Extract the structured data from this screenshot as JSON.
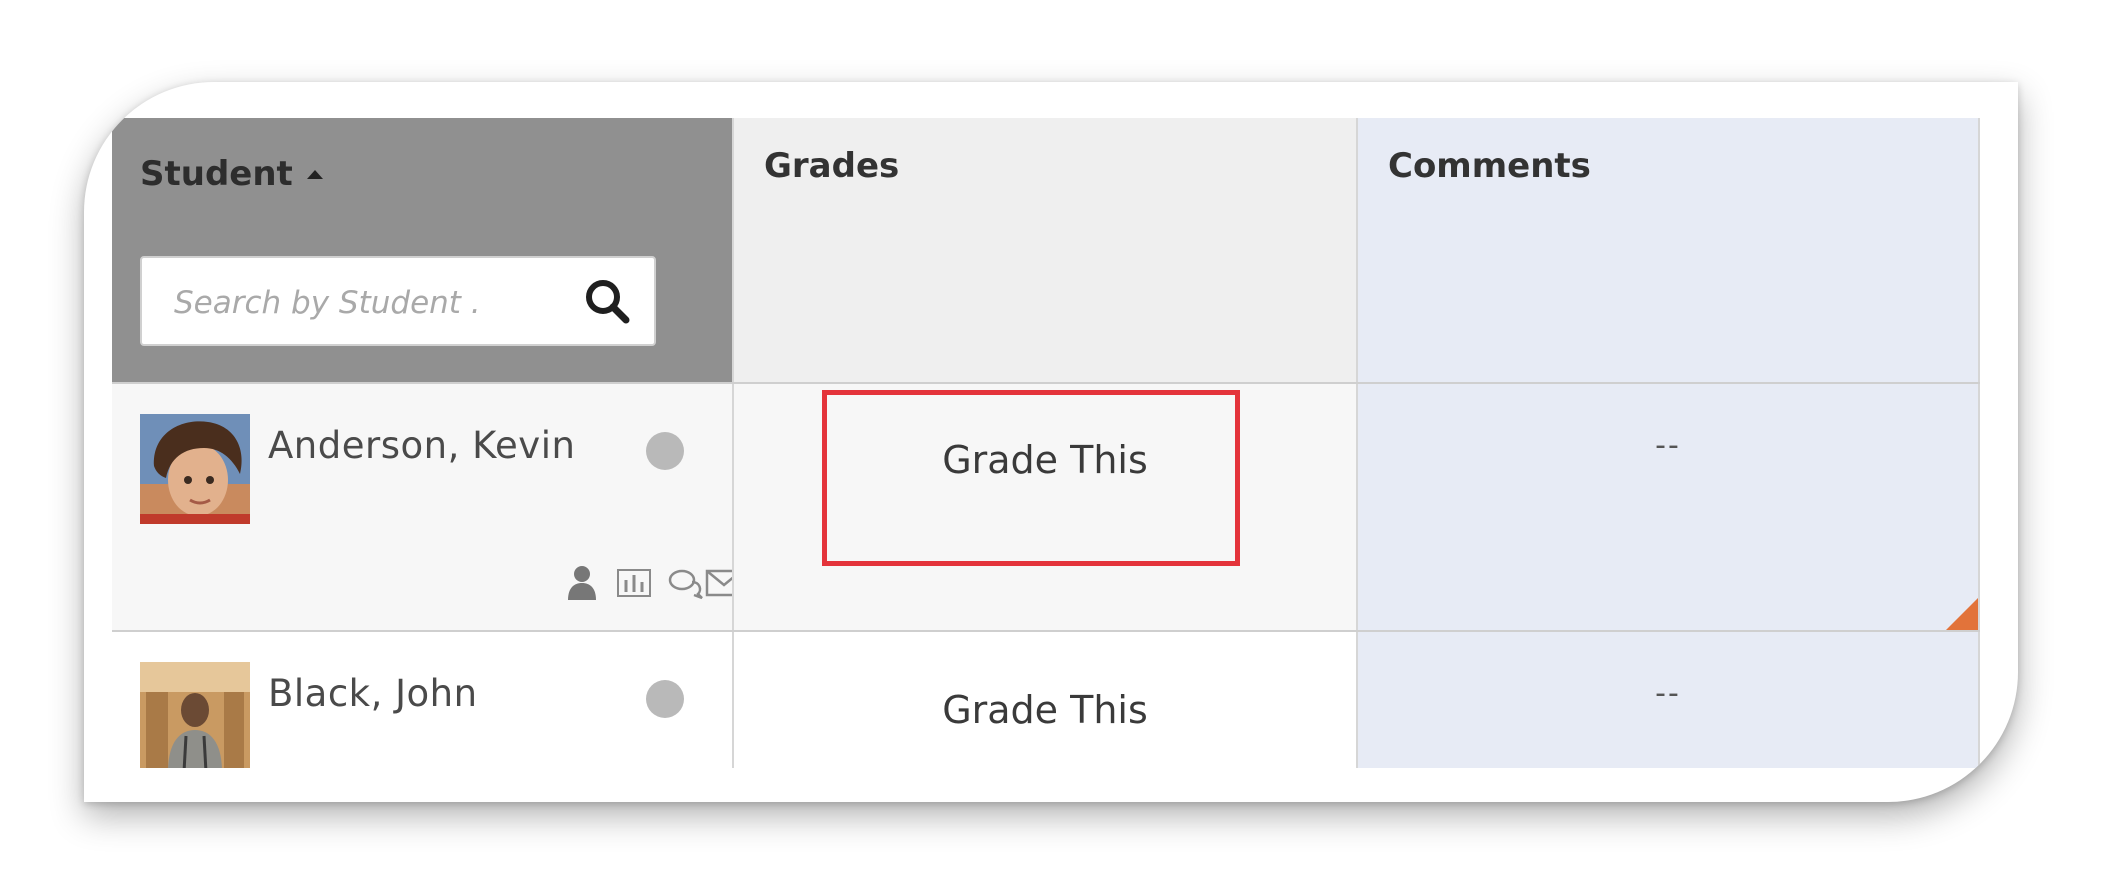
{
  "table": {
    "columns": {
      "student": "Student",
      "grades": "Grades",
      "comments": "Comments"
    },
    "search": {
      "placeholder": "Search by Student .",
      "value": ""
    },
    "rows": [
      {
        "name": "Anderson, Kevin",
        "grade_action": "Grade This",
        "comment": "--",
        "status": "offline"
      },
      {
        "name": "Black, John",
        "grade_action": "Grade This",
        "comment": "--",
        "status": "offline"
      }
    ]
  },
  "icons": {
    "sort": "sort-ascending-icon",
    "search": "search-icon",
    "profile": "user-icon",
    "progress": "bar-chart-icon",
    "discuss": "chat-icon",
    "mail": "mail-icon"
  },
  "colors": {
    "highlight": "#e4343b",
    "corner_flag": "#e2733a",
    "student_header": "#909090",
    "comments_column": "#e7ebf5"
  }
}
